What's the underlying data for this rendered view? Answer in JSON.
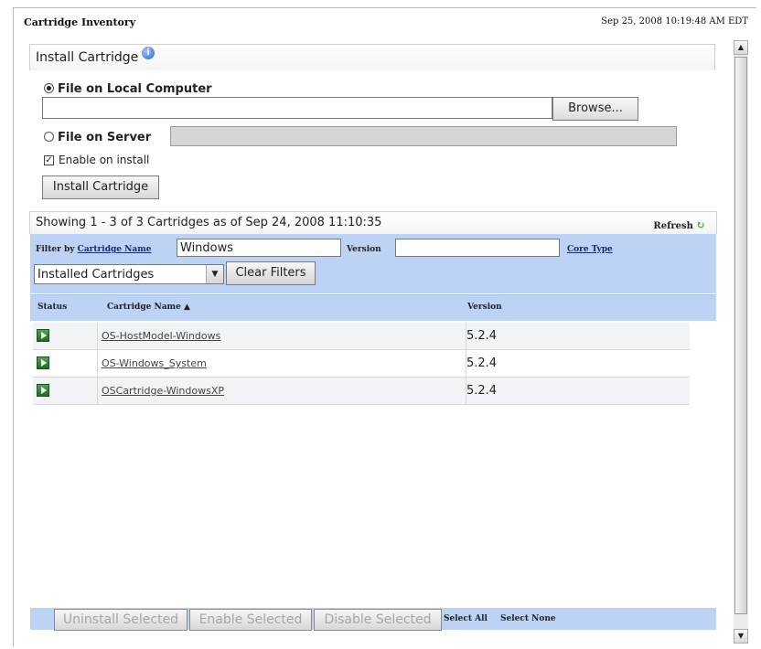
{
  "header": {
    "title": "Cartridge Inventory",
    "timestamp": "Sep 25, 2008 10:19:48 AM EDT"
  },
  "install": {
    "title": "Install Cartridge",
    "info_icon": "i",
    "local_label": "File on Local Computer",
    "local_selected": true,
    "browse_label": "Browse...",
    "server_label": "File on Server",
    "enable_label": "Enable on install",
    "enable_checked": true,
    "checkmark": "✓",
    "install_button": "Install Cartridge"
  },
  "table": {
    "showing_text": "Showing 1 - 3  of 3 Cartridges as of Sep 24, 2008 11:10:35",
    "refresh_label": "Refresh",
    "refresh_icon": "↻",
    "filter_prefix": "Filter by",
    "filter_link": "Cartridge Name",
    "filter_value": "Windows",
    "version_label": "Version",
    "version_value": "",
    "core_type_link": "Core Type",
    "select_value": "Installed Cartridges",
    "select_arrow": "▼",
    "clear_filters": "Clear Filters",
    "columns": {
      "status": "Status",
      "name": "Cartridge Name ▲",
      "version": "Version"
    },
    "rows": [
      {
        "name": "OS-HostModel-Windows",
        "version": "5.2.4"
      },
      {
        "name": "OS-Windows_System",
        "version": "5.2.4"
      },
      {
        "name": "OSCartridge-WindowsXP",
        "version": "5.2.4"
      }
    ]
  },
  "footer": {
    "uninstall": "Uninstall Selected",
    "enable": "Enable Selected",
    "disable": "Disable Selected",
    "select_all": "Select All",
    "select_none": "Select None"
  },
  "scrollbar": {
    "up_arrow": "▲",
    "down_arrow": "▼"
  }
}
